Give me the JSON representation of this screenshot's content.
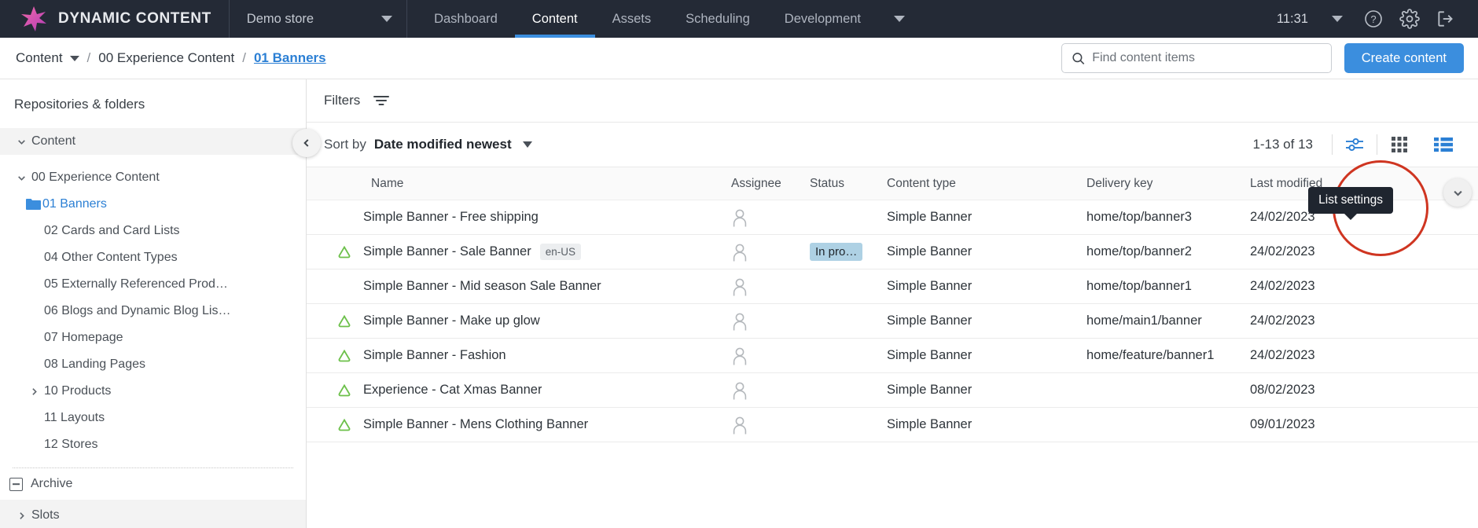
{
  "topnav": {
    "brand": "DYNAMIC CONTENT",
    "store_label": "Demo store",
    "tabs": [
      {
        "label": "Dashboard",
        "active": false
      },
      {
        "label": "Content",
        "active": true
      },
      {
        "label": "Assets",
        "active": false
      },
      {
        "label": "Scheduling",
        "active": false
      },
      {
        "label": "Development",
        "active": false
      }
    ],
    "clock": "11:31",
    "icons": [
      "help-icon",
      "gear-icon",
      "logout-icon"
    ]
  },
  "breadcrumb": {
    "root": "Content",
    "items": [
      "00 Experience Content",
      "01 Banners"
    ],
    "separator": "/"
  },
  "search": {
    "placeholder": "Find content items",
    "value": ""
  },
  "actions": {
    "create_content": "Create content"
  },
  "sidebar": {
    "title": "Repositories & folders",
    "tree": [
      {
        "label": "Content",
        "depth": 0,
        "twisty": "down",
        "shaded": true,
        "selected": false,
        "folder": false
      },
      {
        "label": "00 Experience Content",
        "depth": 1,
        "twisty": "down",
        "shaded": false,
        "selected": false,
        "folder": false
      },
      {
        "label": "01 Banners",
        "depth": 2,
        "twisty": "none",
        "shaded": false,
        "selected": true,
        "folder": true
      },
      {
        "label": "02 Cards and Card Lists",
        "depth": 2,
        "twisty": "none",
        "shaded": false,
        "selected": false,
        "folder": false
      },
      {
        "label": "04 Other Content Types",
        "depth": 2,
        "twisty": "none",
        "shaded": false,
        "selected": false,
        "folder": false
      },
      {
        "label": "05 Externally Referenced Prod…",
        "depth": 2,
        "twisty": "none",
        "shaded": false,
        "selected": false,
        "folder": false
      },
      {
        "label": "06 Blogs and Dynamic Blog Lis…",
        "depth": 2,
        "twisty": "none",
        "shaded": false,
        "selected": false,
        "folder": false
      },
      {
        "label": "07 Homepage",
        "depth": 2,
        "twisty": "none",
        "shaded": false,
        "selected": false,
        "folder": false
      },
      {
        "label": "08 Landing Pages",
        "depth": 2,
        "twisty": "none",
        "shaded": false,
        "selected": false,
        "folder": false
      },
      {
        "label": "10 Products",
        "depth": 2,
        "twisty": "right",
        "shaded": false,
        "selected": false,
        "folder": false
      },
      {
        "label": "11 Layouts",
        "depth": 2,
        "twisty": "none",
        "shaded": false,
        "selected": false,
        "folder": false
      },
      {
        "label": "12 Stores",
        "depth": 2,
        "twisty": "none",
        "shaded": false,
        "selected": false,
        "folder": false
      }
    ],
    "archive": "Archive",
    "slots": "Slots"
  },
  "filters": {
    "label": "Filters",
    "icon": "filter-icon"
  },
  "sort": {
    "label": "Sort by",
    "value": "Date modified newest"
  },
  "pagination": {
    "count": "1-13 of 13"
  },
  "tooltip": {
    "text": "List settings"
  },
  "view_toggles": {
    "list_settings": "list-settings-icon",
    "grid_view": "grid-view-icon",
    "list_view": "list-view-icon"
  },
  "table": {
    "columns": [
      "Name",
      "Assignee",
      "Status",
      "Content type",
      "Delivery key",
      "Last modified"
    ],
    "rows": [
      {
        "cloud": false,
        "name": "Simple Banner - Free shipping",
        "locale": "",
        "status": "",
        "content_type": "Simple Banner",
        "delivery_key": "home/top/banner3",
        "last_modified": "24/02/2023"
      },
      {
        "cloud": true,
        "name": "Simple Banner - Sale Banner",
        "locale": "en-US",
        "status": "In pro…",
        "content_type": "Simple Banner",
        "delivery_key": "home/top/banner2",
        "last_modified": "24/02/2023"
      },
      {
        "cloud": false,
        "name": "Simple Banner - Mid season Sale Banner",
        "locale": "",
        "status": "",
        "content_type": "Simple Banner",
        "delivery_key": "home/top/banner1",
        "last_modified": "24/02/2023"
      },
      {
        "cloud": true,
        "name": "Simple Banner - Make up glow",
        "locale": "",
        "status": "",
        "content_type": "Simple Banner",
        "delivery_key": "home/main1/banner",
        "last_modified": "24/02/2023"
      },
      {
        "cloud": true,
        "name": "Simple Banner - Fashion",
        "locale": "",
        "status": "",
        "content_type": "Simple Banner",
        "delivery_key": "home/feature/banner1",
        "last_modified": "24/02/2023"
      },
      {
        "cloud": true,
        "name": "Experience - Cat Xmas Banner",
        "locale": "",
        "status": "",
        "content_type": "Simple Banner",
        "delivery_key": "",
        "last_modified": "08/02/2023"
      },
      {
        "cloud": true,
        "name": "Simple Banner - Mens Clothing Banner",
        "locale": "",
        "status": "",
        "content_type": "Simple Banner",
        "delivery_key": "",
        "last_modified": "09/01/2023"
      }
    ]
  },
  "colors": {
    "nav_bg": "#242a36",
    "accent_blue": "#3b8ede",
    "link_blue": "#2b7fd4",
    "cloud_green": "#6cc04a",
    "status_chip": "#aed1e4",
    "annotation_red": "#cf3521"
  }
}
